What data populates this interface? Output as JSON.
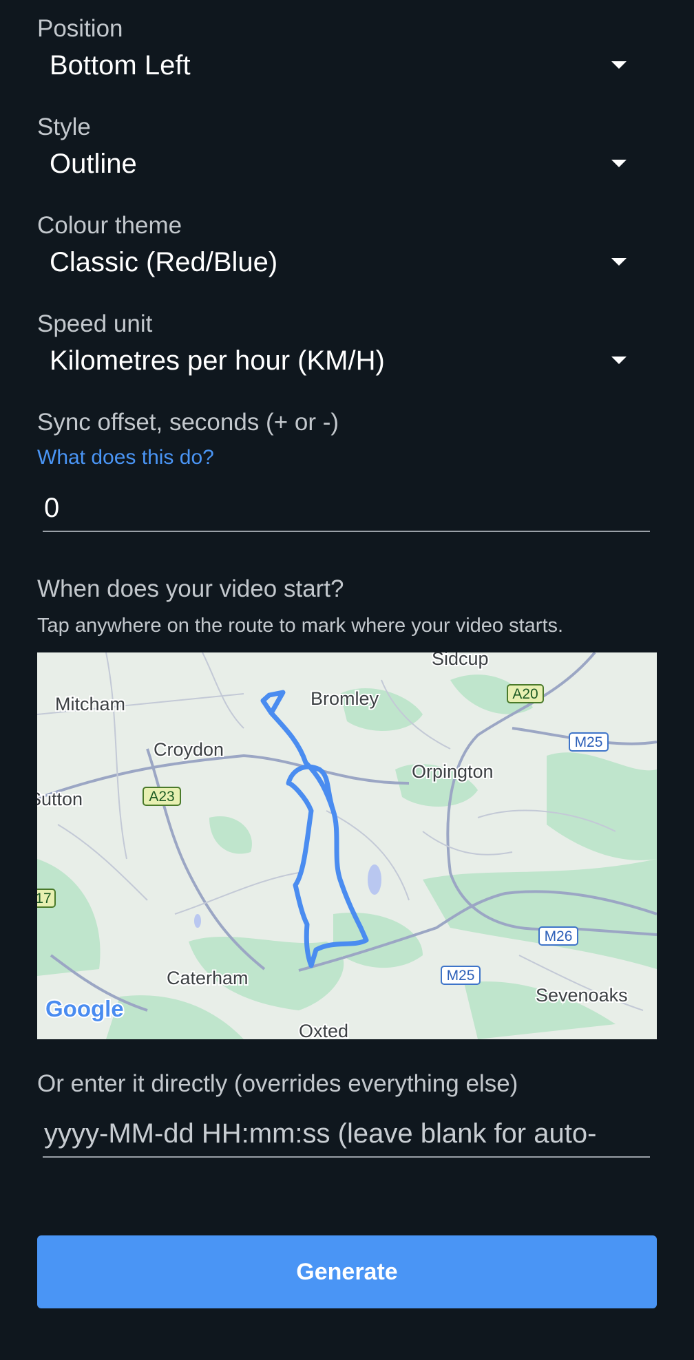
{
  "position": {
    "label": "Position",
    "value": "Bottom Left"
  },
  "style": {
    "label": "Style",
    "value": "Outline"
  },
  "colour_theme": {
    "label": "Colour theme",
    "value": "Classic (Red/Blue)"
  },
  "speed_unit": {
    "label": "Speed unit",
    "value": "Kilometres per hour (KM/H)"
  },
  "sync_offset": {
    "label": "Sync offset, seconds (+ or -)",
    "help_link": "What does this do?",
    "value": "0"
  },
  "video_start": {
    "heading": "When does your video start?",
    "instruction": "Tap anywhere on the route to mark where your video starts.",
    "map": {
      "places": [
        "Sidcup",
        "Mitcham",
        "Bromley",
        "Croydon",
        "Orpington",
        "Sutton",
        "Caterham",
        "Sevenoaks",
        "Oxted"
      ],
      "road_shields": [
        "A20",
        "M25",
        "A23",
        "17",
        "M26",
        "M25"
      ],
      "attribution": "Google",
      "route_color": "#4a8cf0"
    }
  },
  "direct_entry": {
    "label": "Or enter it directly (overrides everything else)",
    "placeholder": "yyyy-MM-dd HH:mm:ss (leave blank for auto-"
  },
  "generate_button": {
    "label": "Generate"
  }
}
